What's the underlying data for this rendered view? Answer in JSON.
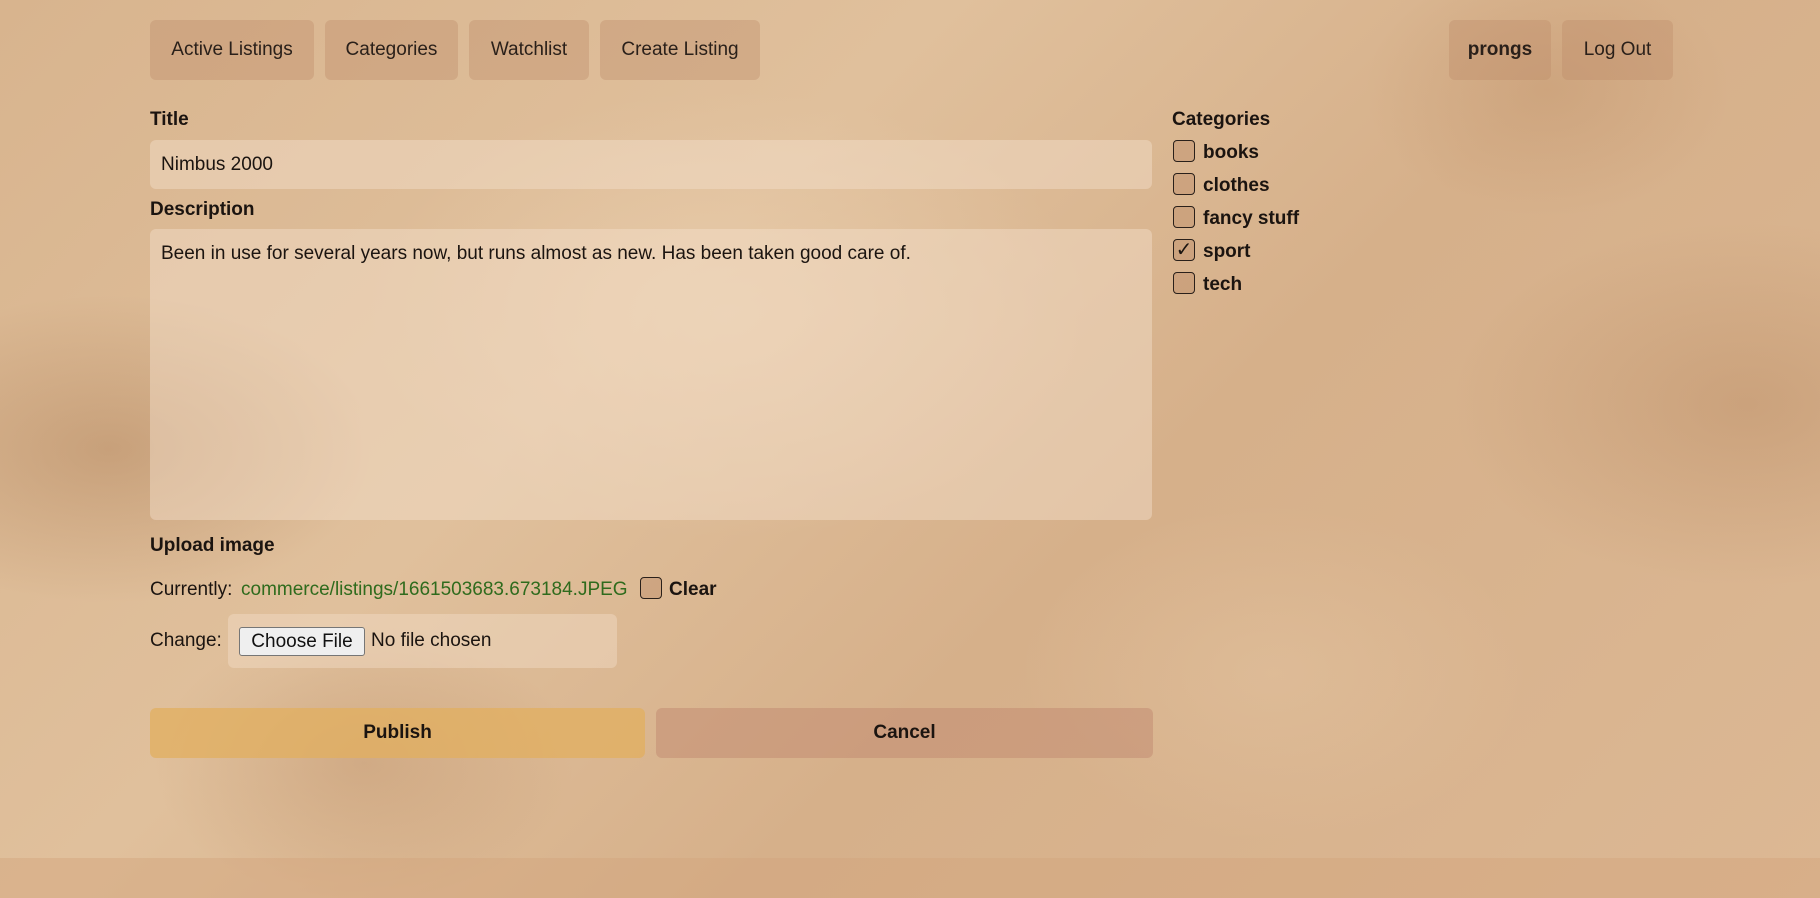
{
  "nav": {
    "active_listings": "Active Listings",
    "categories": "Categories",
    "watchlist": "Watchlist",
    "create_listing": "Create Listing",
    "username": "prongs",
    "logout": "Log Out"
  },
  "form": {
    "title_label": "Title",
    "title_value": "Nimbus 2000",
    "description_label": "Description",
    "description_value": "Been in use for several years now, but runs almost as new. Has been taken good care of.",
    "upload_label": "Upload image",
    "currently_label": "Currently:",
    "current_file": "commerce/listings/1661503683.673184.JPEG",
    "clear_label": "Clear",
    "clear_checked": false,
    "change_label": "Change:",
    "choose_file_label": "Choose File",
    "no_file_text": "No file chosen",
    "publish_label": "Publish",
    "cancel_label": "Cancel"
  },
  "categories": {
    "heading": "Categories",
    "items": [
      {
        "label": "books",
        "checked": false
      },
      {
        "label": "clothes",
        "checked": false
      },
      {
        "label": "fancy stuff",
        "checked": false
      },
      {
        "label": "sport",
        "checked": true
      },
      {
        "label": "tech",
        "checked": false
      }
    ]
  },
  "colors": {
    "publish": "#dcb26a",
    "cancel": "#cfa186",
    "link": "#2f6b1d"
  }
}
